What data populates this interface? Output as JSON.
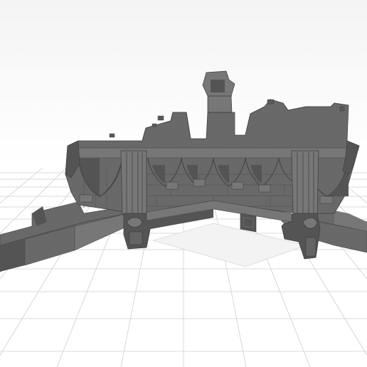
{
  "viewport": {
    "background": "#ffffff",
    "grid_color": "#c8c8c8",
    "model_color": "#6b6b6b",
    "model_shadow": "#4a4a4a",
    "model_highlight": "#8a8a8a"
  },
  "scene": {
    "model_name_icon": "gothic-ruin-wall-model",
    "grid_name": "ground-grid"
  }
}
